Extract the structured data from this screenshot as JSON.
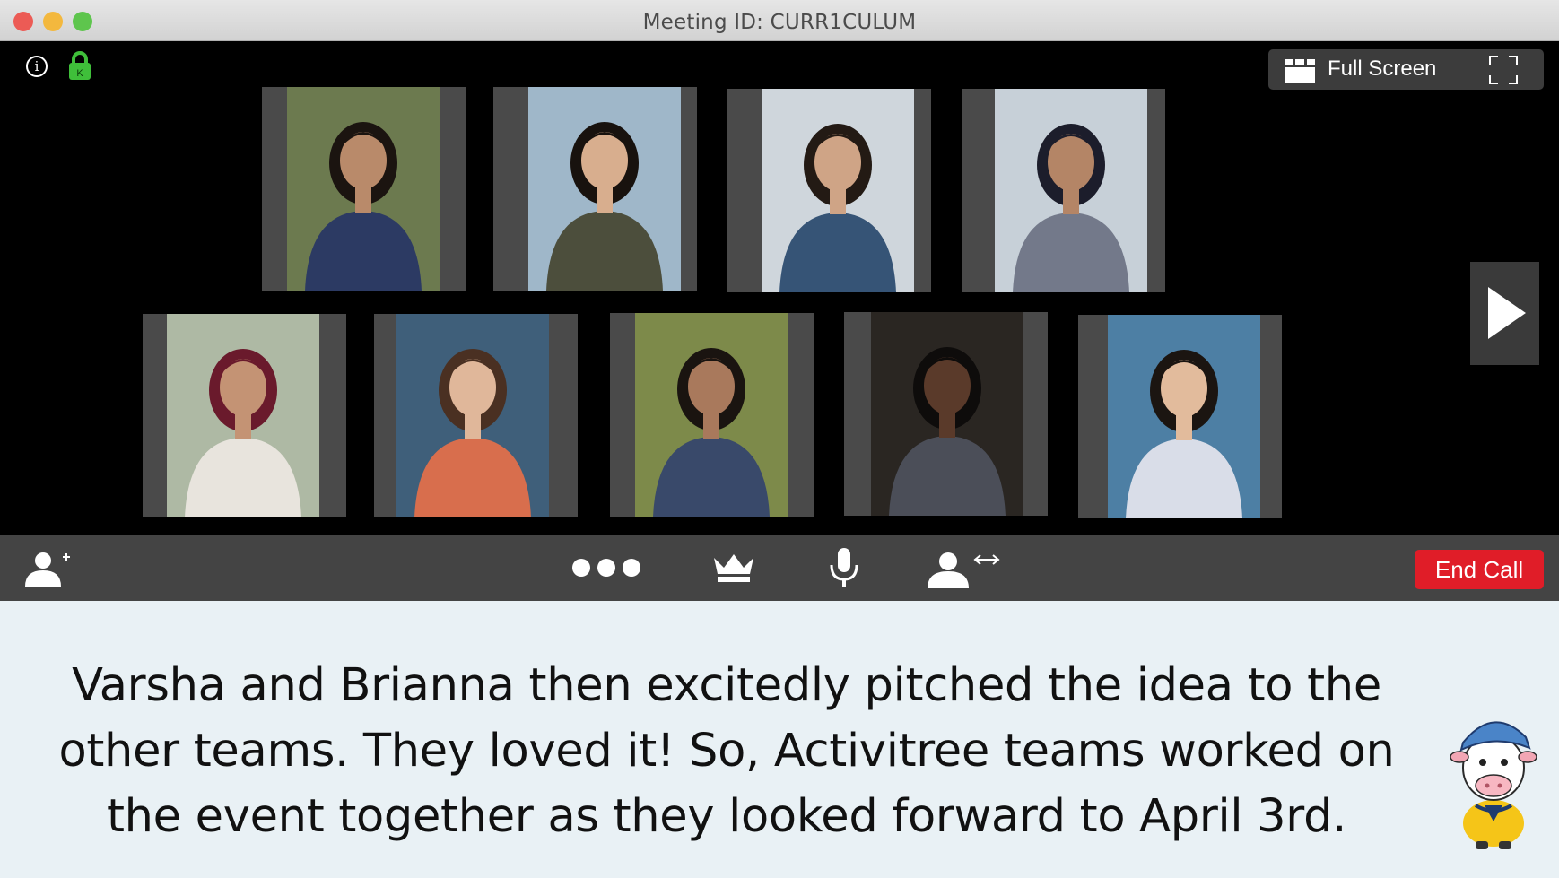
{
  "window": {
    "title": "Meeting ID: CURR1CULUM",
    "controls": [
      "close",
      "minimize",
      "maximize"
    ]
  },
  "top_left_icons": [
    {
      "name": "info-icon",
      "glyph": "i"
    },
    {
      "name": "lock-icon",
      "glyph": "K",
      "color": "#3fbf3a"
    }
  ],
  "full_screen_button": {
    "label": "Full Screen",
    "icons": [
      "grid-view-icon",
      "fullscreen-corners-icon"
    ]
  },
  "participants": [
    {
      "shirt": "#2c3a63",
      "bg": "#6c7a4f",
      "skin": "#b98a6a",
      "hair": "#1b1410"
    },
    {
      "shirt": "#4c4e3c",
      "bg": "#9fb7c9",
      "skin": "#d8ae8e",
      "hair": "#18120e"
    },
    {
      "shirt": "#365476",
      "bg": "#cfd6dc",
      "skin": "#cfa486",
      "hair": "#231a14"
    },
    {
      "shirt": "#73798a",
      "bg": "#c7d0d8",
      "skin": "#b48566",
      "hair": "#1c1d2b"
    },
    {
      "shirt": "#e8e4dd",
      "bg": "#aeb9a4",
      "skin": "#c49374",
      "hair": "#6a1a2c"
    },
    {
      "shirt": "#d86e4d",
      "bg": "#3f5f7a",
      "skin": "#e0b79a",
      "hair": "#4a3022"
    },
    {
      "shirt": "#39496a",
      "bg": "#7d8a4a",
      "skin": "#a9795c",
      "hair": "#1a1410"
    },
    {
      "shirt": "#4b4e58",
      "bg": "#2a2622",
      "skin": "#5a3a2a",
      "hair": "#0e0c0b"
    },
    {
      "shirt": "#d9dde8",
      "bg": "#4d7fa4",
      "skin": "#e2bb9c",
      "hair": "#1b1511"
    }
  ],
  "navigation": {
    "next_icon": "play-right-icon"
  },
  "toolbar": {
    "left_icon": "add-participant-icon",
    "center_icons": [
      "more-options-icon",
      "crown-icon",
      "microphone-icon",
      "switch-user-icon"
    ],
    "end_call_label": "End Call",
    "end_call_color": "#e01d28"
  },
  "caption": {
    "text": "Varsha and Brianna then excitedly pitched the idea to the other teams. They loved it! So, Activitree teams worked on the event together as they looked forward to April 3rd."
  },
  "mascot": {
    "icon": "cow-mascot-icon"
  }
}
